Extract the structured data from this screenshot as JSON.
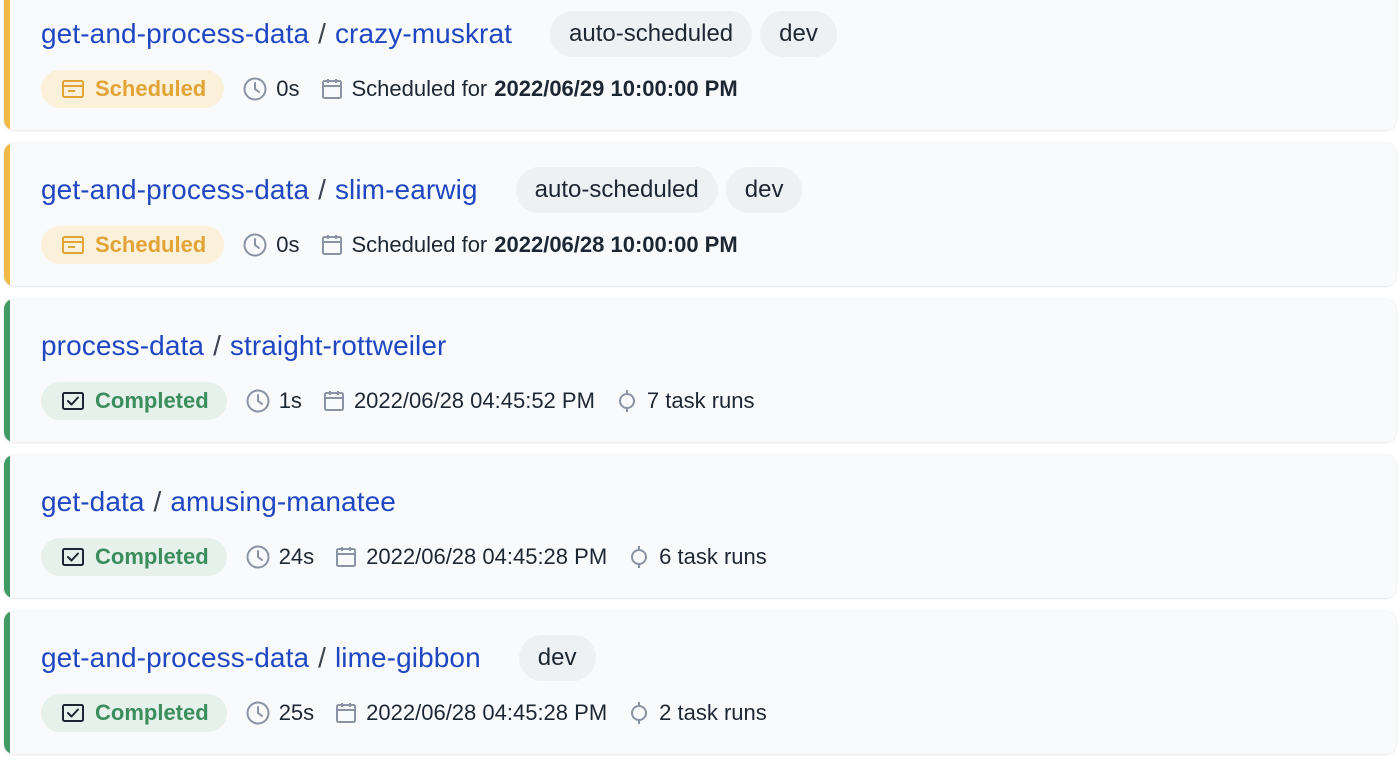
{
  "colors": {
    "link": "#1f47c2",
    "scheduled_accent": "#f1b949",
    "completed_accent": "#3f9a63",
    "scheduled_text": "#e3a437",
    "completed_text": "#3b8e5c"
  },
  "runs": [
    {
      "flow_name": "get-and-process-data",
      "separator": "/",
      "run_name": "crazy-muskrat",
      "tags": [
        "auto-scheduled",
        "dev"
      ],
      "state": "Scheduled",
      "state_icon": "calendar-ticket-icon",
      "duration": "0s",
      "time_prefix": "Scheduled for",
      "time": "2022/06/29 10:00:00 PM",
      "task_runs": null
    },
    {
      "flow_name": "get-and-process-data",
      "separator": "/",
      "run_name": "slim-earwig",
      "tags": [
        "auto-scheduled",
        "dev"
      ],
      "state": "Scheduled",
      "state_icon": "calendar-ticket-icon",
      "duration": "0s",
      "time_prefix": "Scheduled for",
      "time": "2022/06/28 10:00:00 PM",
      "task_runs": null
    },
    {
      "flow_name": "process-data",
      "separator": "/",
      "run_name": "straight-rottweiler",
      "tags": [],
      "state": "Completed",
      "state_icon": "check-square-icon",
      "duration": "1s",
      "time_prefix": "",
      "time": "2022/06/28 04:45:52 PM",
      "task_runs": "7 task runs"
    },
    {
      "flow_name": "get-data",
      "separator": "/",
      "run_name": "amusing-manatee",
      "tags": [],
      "state": "Completed",
      "state_icon": "check-square-icon",
      "duration": "24s",
      "time_prefix": "",
      "time": "2022/06/28 04:45:28 PM",
      "task_runs": "6 task runs"
    },
    {
      "flow_name": "get-and-process-data",
      "separator": "/",
      "run_name": "lime-gibbon",
      "tags": [
        "dev"
      ],
      "state": "Completed",
      "state_icon": "check-square-icon",
      "duration": "25s",
      "time_prefix": "",
      "time": "2022/06/28 04:45:28 PM",
      "task_runs": "2 task runs"
    }
  ]
}
